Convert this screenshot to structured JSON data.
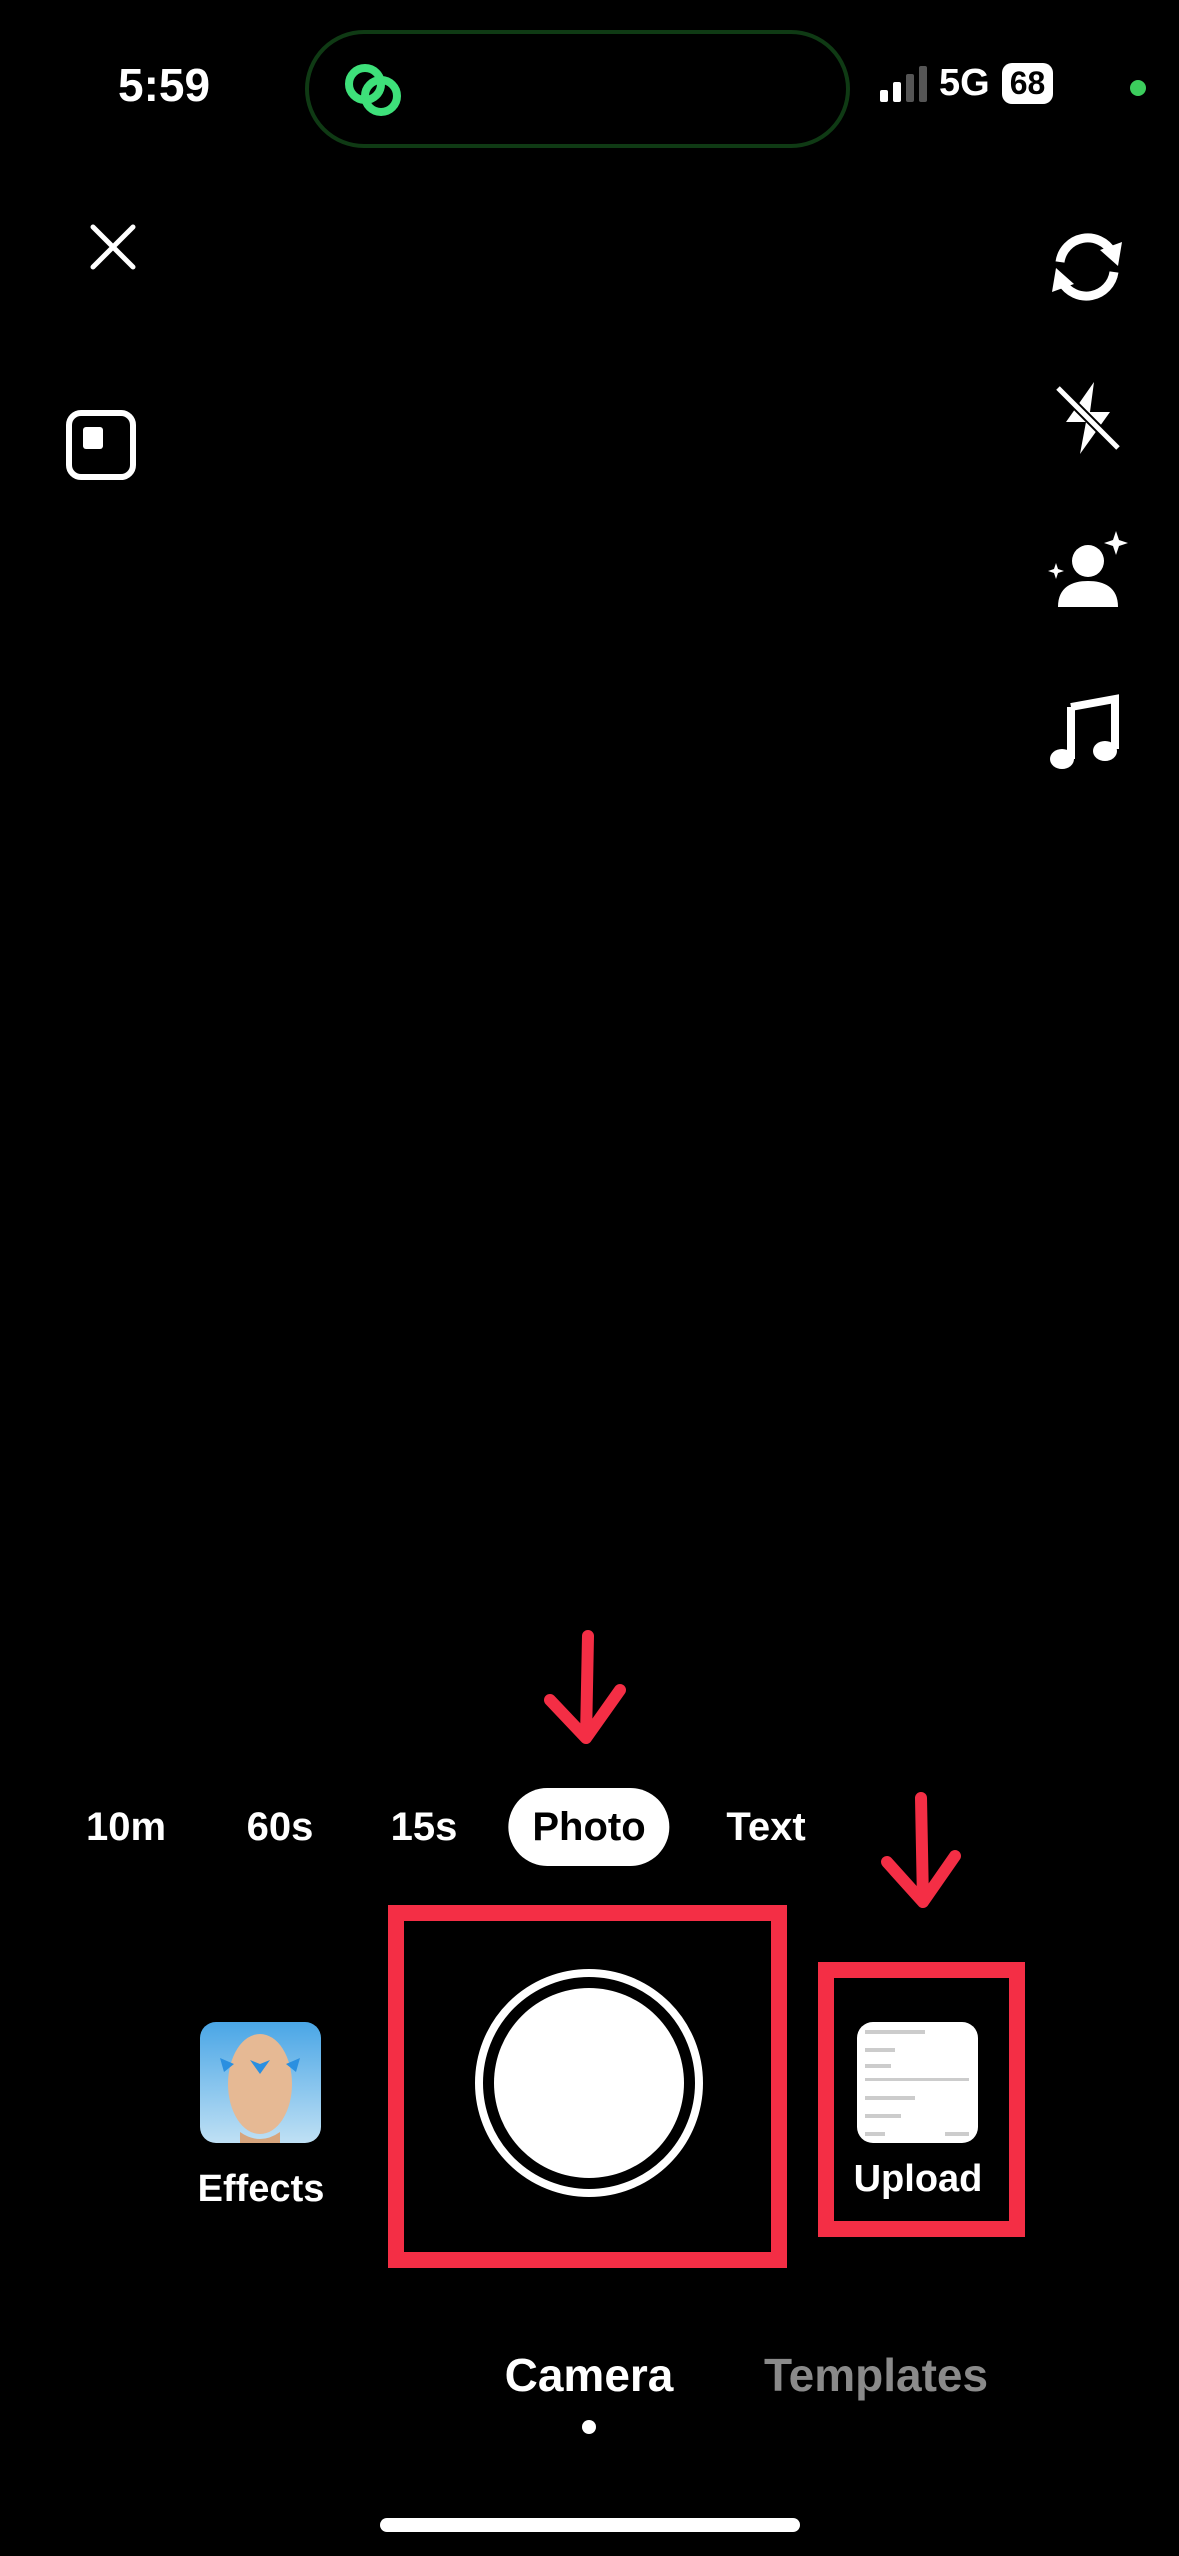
{
  "status_bar": {
    "time": "5:59",
    "network": "5G",
    "battery": "68",
    "signal_bars": 2
  },
  "top_controls": {
    "close_icon": "close-icon",
    "layout_icon": "square-layout-icon"
  },
  "right_toolbar": [
    "flip-camera-icon",
    "flash-off-icon",
    "enhance-person-icon",
    "music-note-icon"
  ],
  "modes": [
    {
      "label": "10m",
      "active": false
    },
    {
      "label": "60s",
      "active": false
    },
    {
      "label": "15s",
      "active": false
    },
    {
      "label": "Photo",
      "active": true
    },
    {
      "label": "Text",
      "active": false
    }
  ],
  "effects": {
    "label": "Effects"
  },
  "upload": {
    "label": "Upload"
  },
  "bottom_tabs": [
    {
      "label": "Camera",
      "active": true
    },
    {
      "label": "Templates",
      "active": false
    }
  ],
  "colors": {
    "annotation_red": "#f42e45",
    "island_green": "#3ee07a",
    "inactive_tab": "#8a8a8a"
  }
}
